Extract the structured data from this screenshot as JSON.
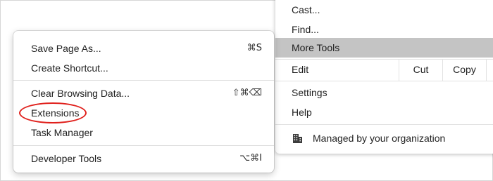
{
  "main_menu": {
    "items": [
      {
        "label": "Cast..."
      },
      {
        "label": "Find..."
      },
      {
        "label": "More Tools",
        "highlighted": true
      }
    ],
    "edit": {
      "label": "Edit",
      "cut": "Cut",
      "copy": "Copy"
    },
    "settings": "Settings",
    "help": "Help",
    "managed": {
      "label": "Managed by your organization",
      "icon": "building-icon"
    }
  },
  "submenu": {
    "items": [
      {
        "label": "Save Page As...",
        "shortcut": "⌘S"
      },
      {
        "label": "Create Shortcut..."
      },
      {
        "label": "Clear Browsing Data...",
        "shortcut": "⇧⌘⌫"
      },
      {
        "label": "Extensions",
        "annotated": true
      },
      {
        "label": "Task Manager"
      },
      {
        "label": "Developer Tools",
        "shortcut": "⌥⌘I"
      }
    ]
  },
  "colors": {
    "highlight": "#c4c4c4",
    "annotation": "#e0201c"
  }
}
